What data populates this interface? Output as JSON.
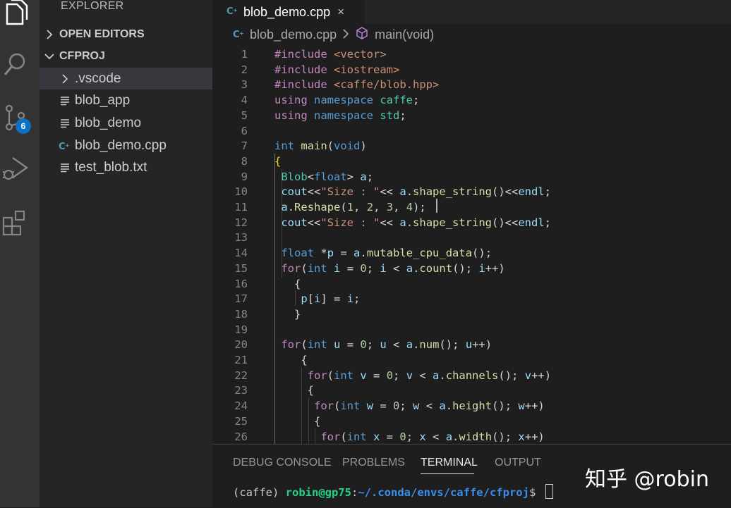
{
  "activity_bar": {
    "icons": [
      "files-icon",
      "search-icon",
      "source-control-icon",
      "run-debug-icon",
      "extensions-icon"
    ],
    "scm_badge": "6"
  },
  "sidebar": {
    "title": "EXPLORER",
    "sections": {
      "open_editors": "OPEN EDITORS",
      "project": "CFPROJ"
    },
    "items": [
      {
        "label": ".vscode",
        "type": "folder"
      },
      {
        "label": "blob_app",
        "type": "file"
      },
      {
        "label": "blob_demo",
        "type": "file"
      },
      {
        "label": "blob_demo.cpp",
        "type": "cpp"
      },
      {
        "label": "test_blob.txt",
        "type": "file"
      }
    ]
  },
  "tab": {
    "label": "blob_demo.cpp",
    "close": "×"
  },
  "breadcrumb": {
    "file": "blob_demo.cpp",
    "symbol": "main(void)"
  },
  "editor": {
    "lines": [
      {
        "n": "1",
        "tokens": [
          [
            "pp",
            "#include "
          ],
          [
            "inc",
            "<vector>"
          ]
        ]
      },
      {
        "n": "2",
        "tokens": [
          [
            "pp",
            "#include "
          ],
          [
            "inc",
            "<iostream>"
          ]
        ]
      },
      {
        "n": "3",
        "tokens": [
          [
            "pp",
            "#include "
          ],
          [
            "inc",
            "<caffe/blob.hpp>"
          ]
        ]
      },
      {
        "n": "4",
        "tokens": [
          [
            "pp",
            "using "
          ],
          [
            "kw",
            "namespace "
          ],
          [
            "ty",
            "caffe"
          ],
          [
            "pl",
            ";"
          ]
        ]
      },
      {
        "n": "5",
        "tokens": [
          [
            "pp",
            "using "
          ],
          [
            "kw",
            "namespace "
          ],
          [
            "ty",
            "std"
          ],
          [
            "pl",
            ";"
          ]
        ]
      },
      {
        "n": "6",
        "tokens": []
      },
      {
        "n": "7",
        "tokens": [
          [
            "kw",
            "int "
          ],
          [
            "fn",
            "main"
          ],
          [
            "pl",
            "("
          ],
          [
            "kw",
            "void"
          ],
          [
            "pl",
            ")"
          ]
        ]
      },
      {
        "n": "8",
        "tokens": [
          [
            "br",
            "{"
          ]
        ]
      },
      {
        "n": "9",
        "tokens": [
          [
            "pl",
            " "
          ],
          [
            "ty",
            "Blob"
          ],
          [
            "pl",
            "<"
          ],
          [
            "kw",
            "float"
          ],
          [
            "pl",
            "> "
          ],
          [
            "var",
            "a"
          ],
          [
            "pl",
            ";"
          ]
        ]
      },
      {
        "n": "10",
        "tokens": [
          [
            "pl",
            " "
          ],
          [
            "var",
            "cout"
          ],
          [
            "pl",
            "<<"
          ],
          [
            "str",
            "\"Size : \""
          ],
          [
            "pl",
            "<< "
          ],
          [
            "var",
            "a"
          ],
          [
            "pl",
            "."
          ],
          [
            "fn",
            "shape_string"
          ],
          [
            "pl",
            "()<<"
          ],
          [
            "var",
            "endl"
          ],
          [
            "pl",
            ";"
          ]
        ]
      },
      {
        "n": "11",
        "tokens": [
          [
            "pl",
            " "
          ],
          [
            "var",
            "a"
          ],
          [
            "pl",
            "."
          ],
          [
            "fn",
            "Reshape"
          ],
          [
            "pl",
            "("
          ],
          [
            "num",
            "1"
          ],
          [
            "pl",
            ", "
          ],
          [
            "num",
            "2"
          ],
          [
            "pl",
            ", "
          ],
          [
            "num",
            "3"
          ],
          [
            "pl",
            ", "
          ],
          [
            "num",
            "4"
          ],
          [
            "pl",
            ");"
          ]
        ]
      },
      {
        "n": "12",
        "tokens": [
          [
            "pl",
            " "
          ],
          [
            "var",
            "cout"
          ],
          [
            "pl",
            "<<"
          ],
          [
            "str",
            "\"Size : \""
          ],
          [
            "pl",
            "<< "
          ],
          [
            "var",
            "a"
          ],
          [
            "pl",
            "."
          ],
          [
            "fn",
            "shape_string"
          ],
          [
            "pl",
            "()<<"
          ],
          [
            "var",
            "endl"
          ],
          [
            "pl",
            ";"
          ]
        ]
      },
      {
        "n": "13",
        "tokens": []
      },
      {
        "n": "14",
        "tokens": [
          [
            "pl",
            " "
          ],
          [
            "kw",
            "float "
          ],
          [
            "pl",
            "*"
          ],
          [
            "var",
            "p"
          ],
          [
            "pl",
            " = "
          ],
          [
            "var",
            "a"
          ],
          [
            "pl",
            "."
          ],
          [
            "fn",
            "mutable_cpu_data"
          ],
          [
            "pl",
            "();"
          ]
        ]
      },
      {
        "n": "15",
        "tokens": [
          [
            "pl",
            " "
          ],
          [
            "pp",
            "for"
          ],
          [
            "pl",
            "("
          ],
          [
            "kw",
            "int "
          ],
          [
            "var",
            "i"
          ],
          [
            "pl",
            " = "
          ],
          [
            "num",
            "0"
          ],
          [
            "pl",
            "; "
          ],
          [
            "var",
            "i"
          ],
          [
            "pl",
            " < "
          ],
          [
            "var",
            "a"
          ],
          [
            "pl",
            "."
          ],
          [
            "fn",
            "count"
          ],
          [
            "pl",
            "(); "
          ],
          [
            "var",
            "i"
          ],
          [
            "pl",
            "++)"
          ]
        ]
      },
      {
        "n": "16",
        "tokens": [
          [
            "pl",
            "   {"
          ]
        ]
      },
      {
        "n": "17",
        "tokens": [
          [
            "pl",
            "    "
          ],
          [
            "var",
            "p"
          ],
          [
            "pl",
            "["
          ],
          [
            "var",
            "i"
          ],
          [
            "pl",
            "] = "
          ],
          [
            "var",
            "i"
          ],
          [
            "pl",
            ";"
          ]
        ]
      },
      {
        "n": "18",
        "tokens": [
          [
            "pl",
            "   }"
          ]
        ]
      },
      {
        "n": "19",
        "tokens": []
      },
      {
        "n": "20",
        "tokens": [
          [
            "pl",
            " "
          ],
          [
            "pp",
            "for"
          ],
          [
            "pl",
            "("
          ],
          [
            "kw",
            "int "
          ],
          [
            "var",
            "u"
          ],
          [
            "pl",
            " = "
          ],
          [
            "num",
            "0"
          ],
          [
            "pl",
            "; "
          ],
          [
            "var",
            "u"
          ],
          [
            "pl",
            " < "
          ],
          [
            "var",
            "a"
          ],
          [
            "pl",
            "."
          ],
          [
            "fn",
            "num"
          ],
          [
            "pl",
            "(); "
          ],
          [
            "var",
            "u"
          ],
          [
            "pl",
            "++)"
          ]
        ]
      },
      {
        "n": "21",
        "tokens": [
          [
            "pl",
            "    {"
          ]
        ]
      },
      {
        "n": "22",
        "tokens": [
          [
            "pl",
            "     "
          ],
          [
            "pp",
            "for"
          ],
          [
            "pl",
            "("
          ],
          [
            "kw",
            "int "
          ],
          [
            "var",
            "v"
          ],
          [
            "pl",
            " = "
          ],
          [
            "num",
            "0"
          ],
          [
            "pl",
            "; "
          ],
          [
            "var",
            "v"
          ],
          [
            "pl",
            " < "
          ],
          [
            "var",
            "a"
          ],
          [
            "pl",
            "."
          ],
          [
            "fn",
            "channels"
          ],
          [
            "pl",
            "(); "
          ],
          [
            "var",
            "v"
          ],
          [
            "pl",
            "++)"
          ]
        ]
      },
      {
        "n": "23",
        "tokens": [
          [
            "pl",
            "     {"
          ]
        ]
      },
      {
        "n": "24",
        "tokens": [
          [
            "pl",
            "      "
          ],
          [
            "pp",
            "for"
          ],
          [
            "pl",
            "("
          ],
          [
            "kw",
            "int "
          ],
          [
            "var",
            "w"
          ],
          [
            "pl",
            " = "
          ],
          [
            "num",
            "0"
          ],
          [
            "pl",
            "; "
          ],
          [
            "var",
            "w"
          ],
          [
            "pl",
            " < "
          ],
          [
            "var",
            "a"
          ],
          [
            "pl",
            "."
          ],
          [
            "fn",
            "height"
          ],
          [
            "pl",
            "(); "
          ],
          [
            "var",
            "w"
          ],
          [
            "pl",
            "++)"
          ]
        ]
      },
      {
        "n": "25",
        "tokens": [
          [
            "pl",
            "      {"
          ]
        ]
      },
      {
        "n": "26",
        "tokens": [
          [
            "pl",
            "       "
          ],
          [
            "pp",
            "for"
          ],
          [
            "pl",
            "("
          ],
          [
            "kw",
            "int "
          ],
          [
            "var",
            "x"
          ],
          [
            "pl",
            " = "
          ],
          [
            "num",
            "0"
          ],
          [
            "pl",
            "; "
          ],
          [
            "var",
            "x"
          ],
          [
            "pl",
            " < "
          ],
          [
            "var",
            "a"
          ],
          [
            "pl",
            "."
          ],
          [
            "fn",
            "width"
          ],
          [
            "pl",
            "(); "
          ],
          [
            "var",
            "x"
          ],
          [
            "pl",
            "++)"
          ]
        ]
      }
    ]
  },
  "panel": {
    "tabs": [
      "DEBUG CONSOLE",
      "PROBLEMS",
      "TERMINAL",
      "OUTPUT"
    ],
    "active_tab": "TERMINAL",
    "terminal": {
      "env": "(caffe) ",
      "user_host": "robin@gp75",
      "sep": ":",
      "path": "~/.conda/envs/caffe/cfproj",
      "prompt": "$ "
    }
  },
  "watermark": "知乎 @robin",
  "colors": {
    "activity_bg": "#333333",
    "sidebar_bg": "#252526",
    "editor_bg": "#1e1e1e",
    "badge": "#0e70c0"
  }
}
